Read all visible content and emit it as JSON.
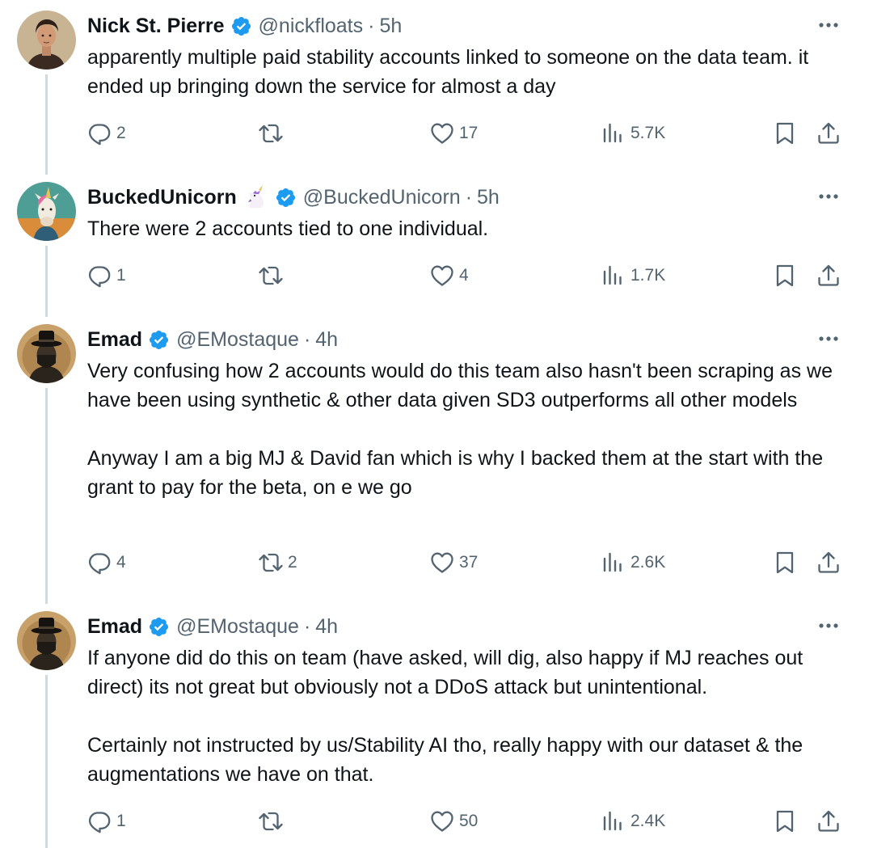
{
  "tweets": [
    {
      "name": "Nick St. Pierre",
      "handle": "@nickfloats",
      "separator": "·",
      "time": "5h",
      "emoji": "",
      "paragraphs": [
        "apparently multiple paid stability accounts linked to  someone on the data team. it ended up bringing down the service for almost a day"
      ],
      "replies": "2",
      "retweets": "",
      "likes": "17",
      "views": "5.7K"
    },
    {
      "name": "BuckedUnicorn",
      "handle": "@BuckedUnicorn",
      "separator": "·",
      "time": "5h",
      "emoji": "unicorn-emoji",
      "paragraphs": [
        "There were 2 accounts tied to one individual."
      ],
      "replies": "1",
      "retweets": "",
      "likes": "4",
      "views": "1.7K"
    },
    {
      "name": "Emad",
      "handle": "@EMostaque",
      "separator": "·",
      "time": "4h",
      "emoji": "",
      "paragraphs": [
        "Very confusing how 2 accounts would do this team also hasn't been scraping as we have been using synthetic & other data given SD3 outperforms all other models",
        "Anyway I am a big MJ & David fan which is why I backed them at the start with the grant to pay for the beta, on e we go"
      ],
      "replies": "4",
      "retweets": "2",
      "likes": "37",
      "views": "2.6K"
    },
    {
      "name": "Emad",
      "handle": "@EMostaque",
      "separator": "·",
      "time": "4h",
      "emoji": "",
      "paragraphs": [
        "If anyone did do this on team (have asked, will dig, also happy if MJ reaches out direct) its not great but obviously not a DDoS attack but unintentional.",
        "Certainly not instructed by us/Stability AI tho, really happy with our dataset & the augmentations we have on that."
      ],
      "replies": "1",
      "retweets": "",
      "likes": "50",
      "views": "2.4K"
    }
  ],
  "colors": {
    "verified": "#1d9bf0",
    "muted": "#536471",
    "text": "#0f1419",
    "thread_line": "#cfd9de"
  },
  "icons": [
    "verified-badge-icon",
    "more-icon",
    "reply-icon",
    "retweet-icon",
    "like-icon",
    "views-icon",
    "bookmark-icon",
    "share-icon"
  ]
}
